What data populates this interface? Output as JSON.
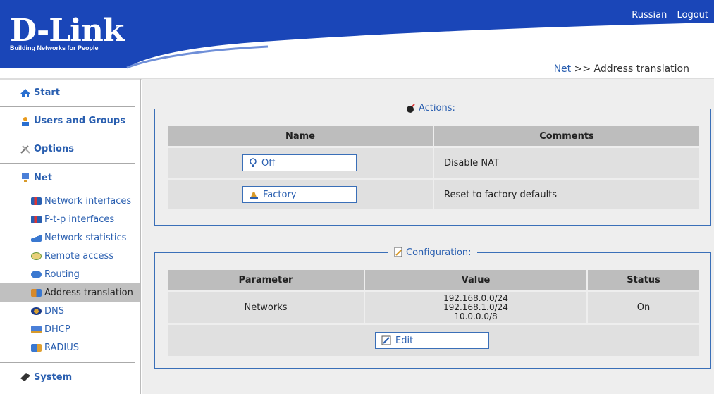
{
  "header": {
    "logo_text": "D-Link",
    "tagline": "Building Networks for People",
    "links": [
      "Russian",
      "Logout"
    ]
  },
  "breadcrumb": {
    "link": "Net",
    "separator": " >> ",
    "current": "Address translation"
  },
  "sidebar": {
    "sections": [
      {
        "label": "Start",
        "icon": "home-icon"
      },
      {
        "label": "Users and Groups",
        "icon": "users-icon"
      },
      {
        "label": "Options",
        "icon": "options-icon"
      },
      {
        "label": "Net",
        "icon": "net-icon"
      },
      {
        "label": "System",
        "icon": "system-icon"
      }
    ],
    "net_items": [
      {
        "label": "Network interfaces",
        "icon": "network-card-icon"
      },
      {
        "label": "P-t-p interfaces",
        "icon": "ptp-card-icon"
      },
      {
        "label": "Network statistics",
        "icon": "statistics-icon"
      },
      {
        "label": "Remote access",
        "icon": "remote-access-icon"
      },
      {
        "label": "Routing",
        "icon": "routing-icon"
      },
      {
        "label": "Address translation",
        "icon": "address-translation-icon",
        "active": true
      },
      {
        "label": "DNS",
        "icon": "dns-icon"
      },
      {
        "label": "DHCP",
        "icon": "dhcp-icon"
      },
      {
        "label": "RADIUS",
        "icon": "radius-icon"
      }
    ]
  },
  "actions": {
    "legend": "Actions:",
    "columns": [
      "Name",
      "Comments"
    ],
    "rows": [
      {
        "button": "Off",
        "icon": "bulb-icon",
        "comment": "Disable NAT"
      },
      {
        "button": "Factory",
        "icon": "factory-icon",
        "comment": "Reset to factory defaults"
      }
    ]
  },
  "configuration": {
    "legend": "Configuration:",
    "columns": [
      "Parameter",
      "Value",
      "Status"
    ],
    "row": {
      "parameter": "Networks",
      "values": [
        "192.168.0.0/24",
        "192.168.1.0/24",
        "10.0.0.0/8"
      ],
      "status": "On"
    },
    "edit_label": "Edit"
  },
  "colors": {
    "brand_blue": "#1a46b8",
    "link_blue": "#2a5fb0",
    "border_blue": "#3a6fb8"
  }
}
